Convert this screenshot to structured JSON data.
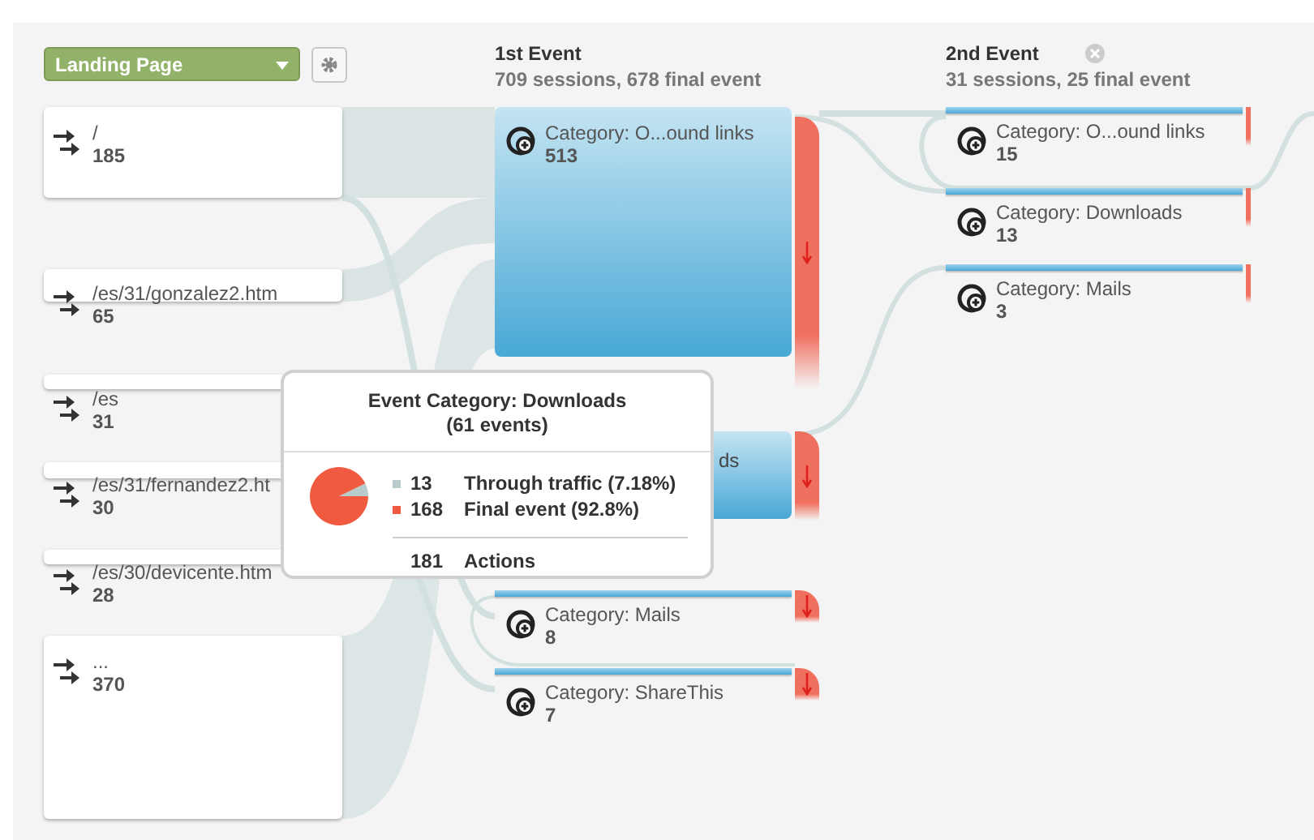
{
  "dimension_selector": {
    "label": "Landing Page"
  },
  "landing_pages": [
    {
      "label": "/",
      "count": "185"
    },
    {
      "label": "/es/31/gonzalez2.htm",
      "count": "65"
    },
    {
      "label": "/es",
      "count": "31"
    },
    {
      "label": "/es/31/fernandez2.ht",
      "count": "30"
    },
    {
      "label": "/es/30/devicente.htm",
      "count": "28"
    },
    {
      "label": "...",
      "count": "370"
    }
  ],
  "columns": [
    {
      "title": "1st Event",
      "summary": "709 sessions, 678 final event",
      "closable": false,
      "nodes": [
        {
          "kind": "block",
          "label": "Category: O...ound links",
          "count": "513"
        },
        {
          "kind": "covered",
          "label": "ds"
        },
        {
          "kind": "bar",
          "label": "Category: Mails",
          "count": "8"
        },
        {
          "kind": "bar",
          "label": "Category: ShareThis",
          "count": "7"
        }
      ]
    },
    {
      "title": "2nd Event",
      "summary": "31 sessions, 25 final event",
      "closable": true,
      "nodes": [
        {
          "kind": "bar",
          "label": "Category: O...ound links",
          "count": "15"
        },
        {
          "kind": "bar",
          "label": "Category: Downloads",
          "count": "13"
        },
        {
          "kind": "bar",
          "label": "Category: Mails",
          "count": "3"
        }
      ]
    }
  ],
  "tooltip": {
    "title": "Event Category: Downloads",
    "subtitle": "(61 events)",
    "rows": [
      {
        "value": "13",
        "label": "Through traffic (7.18%)",
        "color": "#b8cccc"
      },
      {
        "value": "168",
        "label": "Final event (92.8%)",
        "color": "#ef5a40"
      }
    ],
    "total": {
      "value": "181",
      "label": "Actions"
    }
  }
}
